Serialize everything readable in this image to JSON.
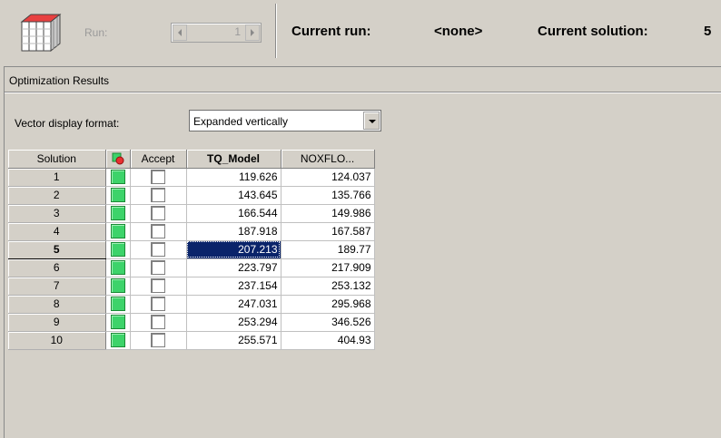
{
  "toolbar": {
    "icon": "data-cube-icon",
    "run_label": "Run:",
    "run_value": "1",
    "current_run_label": "Current run:",
    "current_run_value": "<none>",
    "current_solution_label": "Current solution:",
    "current_solution_value": "5"
  },
  "panel": {
    "title": "Optimization Results",
    "vector_display_label": "Vector display format:",
    "vector_display_value": "Expanded vertically"
  },
  "table": {
    "headers": {
      "solution": "Solution",
      "status_icon": "status-icon",
      "accept": "Accept",
      "tq_model": "TQ_Model",
      "noxflo": "NOXFLO..."
    },
    "selected_row": "5",
    "rows": [
      {
        "solution": "1",
        "tq_model": "119.626",
        "noxflo": "124.037"
      },
      {
        "solution": "2",
        "tq_model": "143.645",
        "noxflo": "135.766"
      },
      {
        "solution": "3",
        "tq_model": "166.544",
        "noxflo": "149.986"
      },
      {
        "solution": "4",
        "tq_model": "187.918",
        "noxflo": "167.587"
      },
      {
        "solution": "5",
        "tq_model": "207.213",
        "noxflo": "189.77"
      },
      {
        "solution": "6",
        "tq_model": "223.797",
        "noxflo": "217.909"
      },
      {
        "solution": "7",
        "tq_model": "237.154",
        "noxflo": "253.132"
      },
      {
        "solution": "8",
        "tq_model": "247.031",
        "noxflo": "295.968"
      },
      {
        "solution": "9",
        "tq_model": "253.294",
        "noxflo": "346.526"
      },
      {
        "solution": "10",
        "tq_model": "255.571",
        "noxflo": "404.93"
      }
    ]
  },
  "colors": {
    "status_green": "#3dd36a",
    "selection": "#0a246a",
    "window_bg": "#d4d0c8"
  }
}
